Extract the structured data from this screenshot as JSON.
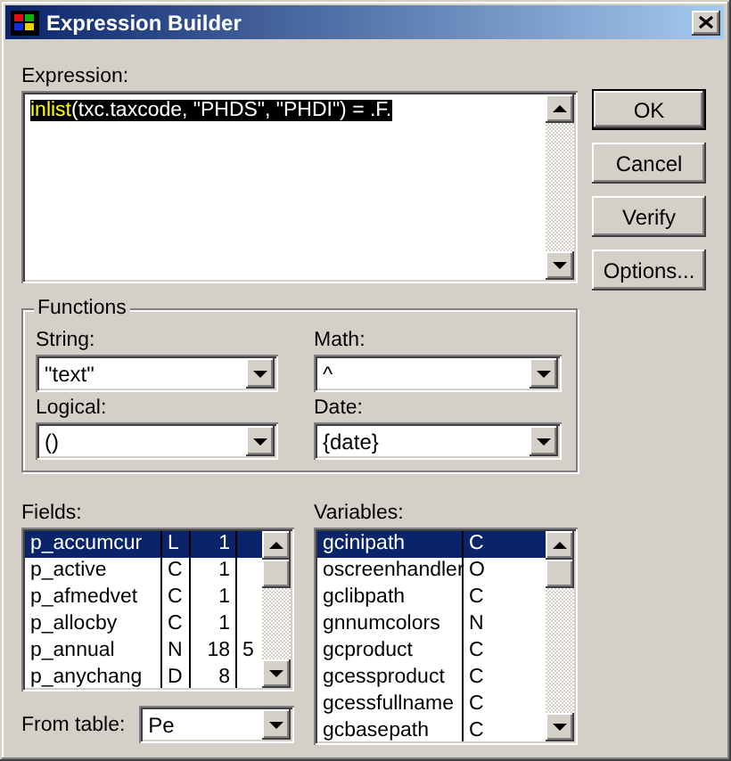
{
  "window": {
    "title": "Expression Builder"
  },
  "expression": {
    "label": "Expression:",
    "selected": true,
    "tokens": [
      {
        "text": "inlist",
        "kind": "keyword"
      },
      {
        "text": "(txc.taxcode, \"PHDS\", \"PHDI\") = .F.",
        "kind": "text"
      }
    ]
  },
  "buttons": [
    {
      "label": "OK",
      "default": true
    },
    {
      "label": "Cancel",
      "default": false
    },
    {
      "label": "Verify",
      "default": false
    },
    {
      "label": "Options...",
      "default": false
    }
  ],
  "functions": {
    "title": "Functions",
    "combos": [
      {
        "label": "String:",
        "value": "\"text\""
      },
      {
        "label": "Math:",
        "value": "^"
      },
      {
        "label": "Logical:",
        "value": "()"
      },
      {
        "label": "Date:",
        "value": "{date}"
      }
    ]
  },
  "fields": {
    "label": "Fields:",
    "rows": [
      {
        "cells": [
          "p_accumcur",
          "L",
          "1",
          ""
        ],
        "selected": true
      },
      {
        "cells": [
          "p_active",
          "C",
          "1",
          ""
        ],
        "selected": false
      },
      {
        "cells": [
          "p_afmedvet",
          "C",
          "1",
          ""
        ],
        "selected": false
      },
      {
        "cells": [
          "p_allocby",
          "C",
          "1",
          ""
        ],
        "selected": false
      },
      {
        "cells": [
          "p_annual",
          "N",
          "18",
          "5"
        ],
        "selected": false
      },
      {
        "cells": [
          "p_anychang",
          "D",
          "8",
          ""
        ],
        "selected": false
      }
    ]
  },
  "from_table": {
    "label": "From table:",
    "value": "Pe"
  },
  "variables": {
    "label": "Variables:",
    "rows": [
      {
        "cells": [
          "gcinipath",
          "C"
        ],
        "selected": true
      },
      {
        "cells": [
          "oscreenhandler",
          "O"
        ],
        "selected": false
      },
      {
        "cells": [
          "gclibpath",
          "C"
        ],
        "selected": false
      },
      {
        "cells": [
          "gnnumcolors",
          "N"
        ],
        "selected": false
      },
      {
        "cells": [
          "gcproduct",
          "C"
        ],
        "selected": false
      },
      {
        "cells": [
          "gcessproduct",
          "C"
        ],
        "selected": false
      },
      {
        "cells": [
          "gcessfullname",
          "C"
        ],
        "selected": false
      },
      {
        "cells": [
          "gcbasepath",
          "C"
        ],
        "selected": false
      }
    ]
  }
}
